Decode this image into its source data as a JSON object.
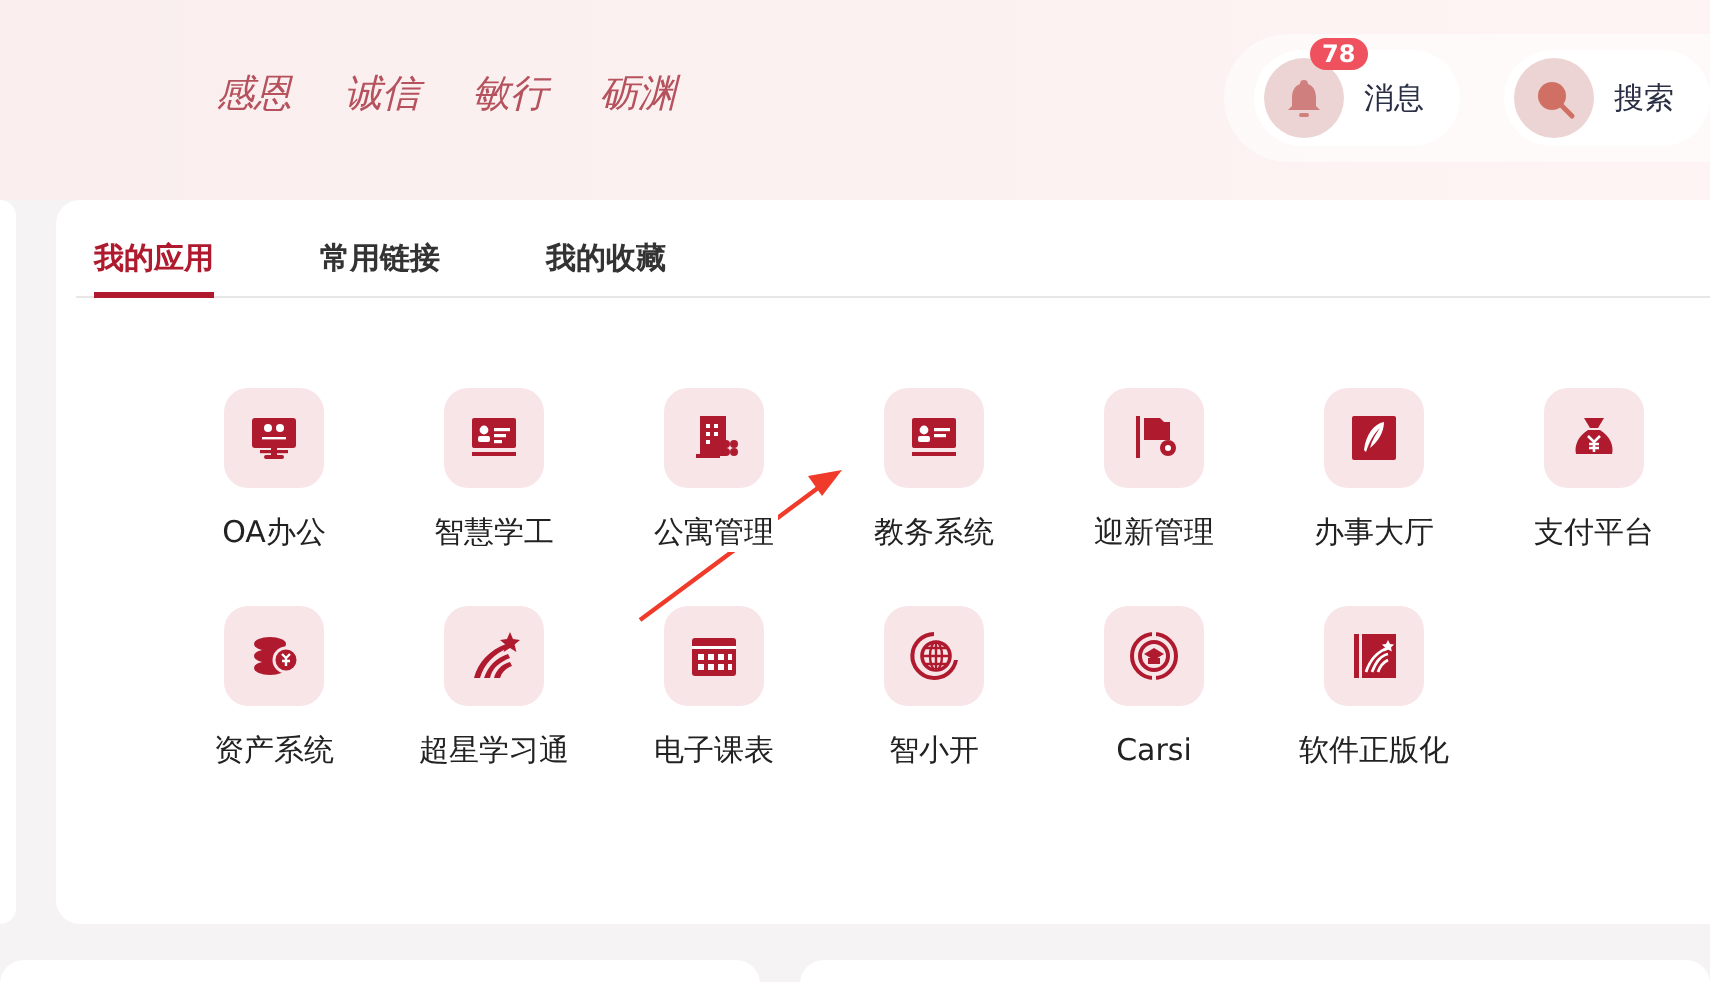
{
  "header": {
    "slogan": [
      "感恩",
      "诚信",
      "敏行",
      "砺渊"
    ],
    "actions": [
      {
        "kind": "notify",
        "label": "消息",
        "badge": "78"
      },
      {
        "kind": "search",
        "label": "搜索"
      }
    ]
  },
  "tabs": [
    {
      "label": "我的应用",
      "selected": true
    },
    {
      "label": "常用链接",
      "selected": false
    },
    {
      "label": "我的收藏",
      "selected": false
    }
  ],
  "apps": [
    {
      "label": "OA办公"
    },
    {
      "label": "智慧学工"
    },
    {
      "label": "公寓管理"
    },
    {
      "label": "教务系统"
    },
    {
      "label": "迎新管理"
    },
    {
      "label": "办事大厅"
    },
    {
      "label": "支付平台"
    },
    {
      "label": "资产系统"
    },
    {
      "label": "超星学习通"
    },
    {
      "label": "电子课表"
    },
    {
      "label": "智小开"
    },
    {
      "label": "Carsi"
    },
    {
      "label": "软件正版化"
    }
  ]
}
